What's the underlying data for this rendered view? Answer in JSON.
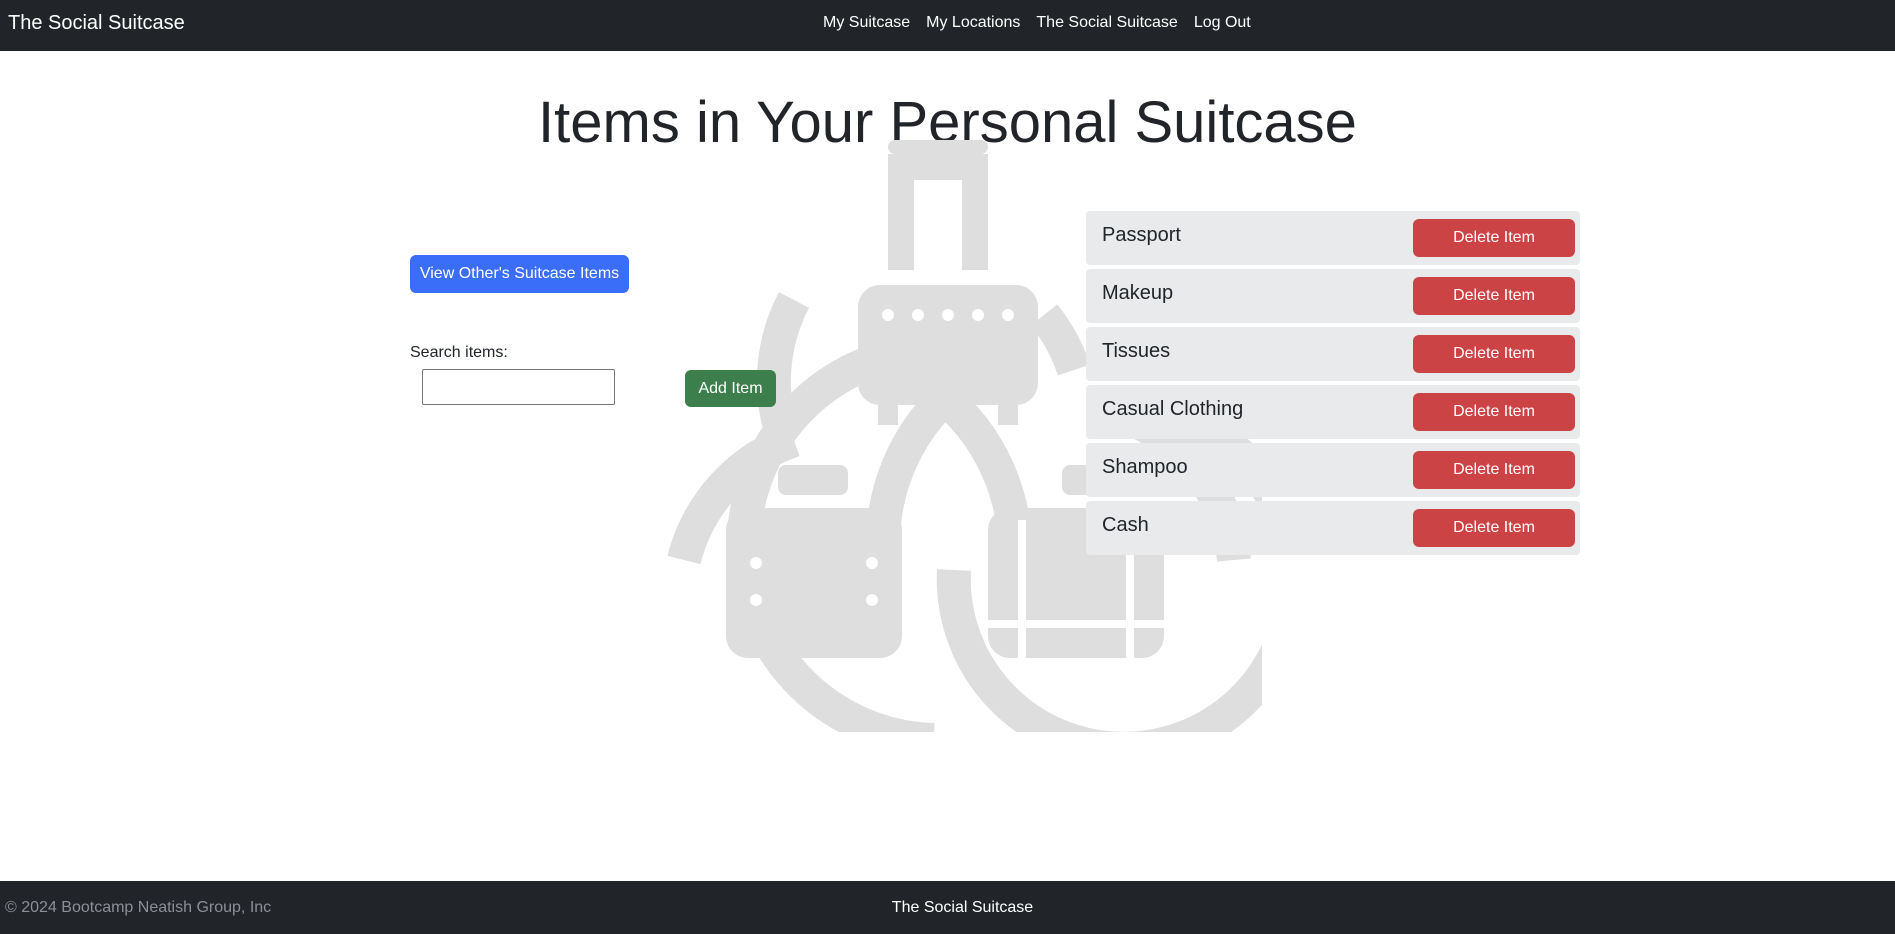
{
  "navbar": {
    "brand": "The Social Suitcase",
    "links": [
      "My Suitcase",
      "My Locations",
      "The Social Suitcase",
      "Log Out"
    ]
  },
  "page": {
    "title": "Items in Your Personal Suitcase"
  },
  "controls": {
    "view_others_label": "View Other's Suitcase Items",
    "search_label": "Search items:",
    "search_value": "",
    "add_item_label": "Add Item"
  },
  "items": [
    {
      "name": "Passport",
      "delete_label": "Delete Item"
    },
    {
      "name": "Makeup",
      "delete_label": "Delete Item"
    },
    {
      "name": "Tissues",
      "delete_label": "Delete Item"
    },
    {
      "name": "Casual Clothing",
      "delete_label": "Delete Item"
    },
    {
      "name": "Shampoo",
      "delete_label": "Delete Item"
    },
    {
      "name": "Cash",
      "delete_label": "Delete Item"
    }
  ],
  "footer": {
    "copyright": "© 2024 Bootcamp Neatish Group, Inc",
    "brand": "The Social Suitcase"
  },
  "colors": {
    "navbar_bg": "#212529",
    "primary_button": "#3b6ef8",
    "success_button": "#3c7f4c",
    "danger_button": "#cc4346",
    "list_item_bg": "#e9eaec",
    "watermark": "#dedede"
  },
  "icons": [
    "suitcase-logo-watermark-icon"
  ]
}
